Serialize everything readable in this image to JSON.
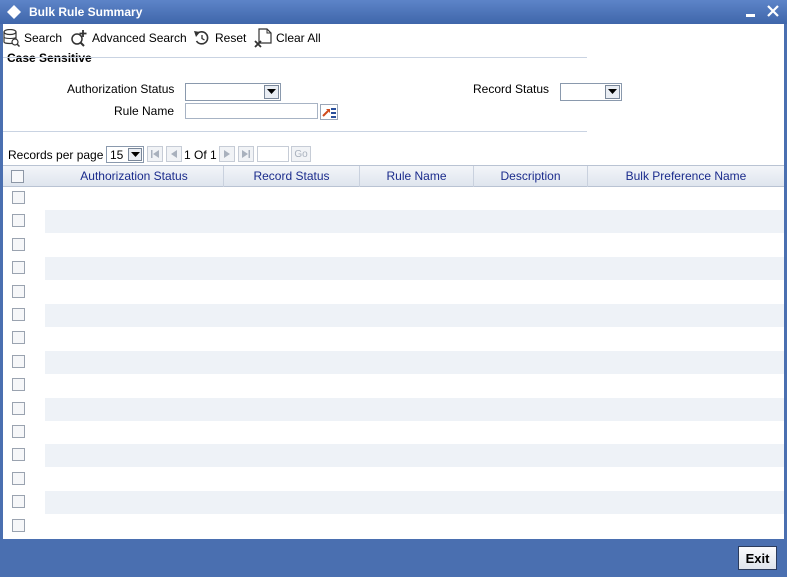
{
  "window": {
    "title": "Bulk Rule Summary"
  },
  "toolbar": {
    "search_label": "Search",
    "advanced_search_label": "Advanced Search",
    "reset_label": "Reset",
    "clear_all_label": "Clear All"
  },
  "criteria": {
    "section_title": "Case Sensitive",
    "authorization_status_label": "Authorization Status",
    "authorization_status_value": "",
    "record_status_label": "Record Status",
    "record_status_value": "",
    "rule_name_label": "Rule Name",
    "rule_name_value": ""
  },
  "pager": {
    "records_per_page_label": "Records per page",
    "records_per_page_value": "15",
    "page_info": "1 Of 1",
    "goto_value": "",
    "go_label": "Go"
  },
  "grid": {
    "columns": [
      "Authorization Status",
      "Record Status",
      "Rule Name",
      "Description",
      "Bulk Preference Name"
    ],
    "empty_rows": 15
  },
  "footer": {
    "exit_label": "Exit"
  },
  "colors": {
    "frame": "#4a6fb0",
    "header_text": "#1a2b8c",
    "alt_row": "#eef2f7"
  }
}
